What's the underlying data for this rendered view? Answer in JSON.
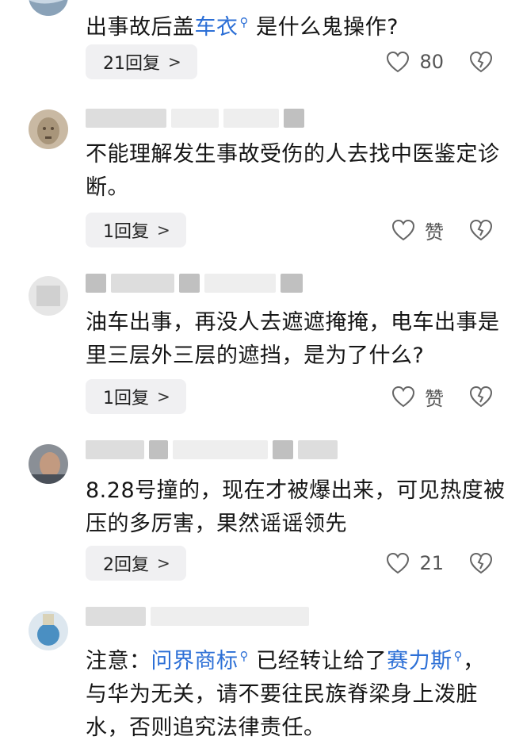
{
  "comments": [
    {
      "text_before": "出事故后盖",
      "link1": "车衣",
      "text_after": "是什么鬼操作?",
      "reply_label": "21回复",
      "like_label": "80"
    },
    {
      "text": "不能理解发生事故受伤的人去找中医鉴定诊断。",
      "reply_label": "1回复",
      "like_label": "赞"
    },
    {
      "text": "油车出事，再没人去遮遮掩掩，电车出事是里三层外三层的遮挡，是为了什么?",
      "reply_label": "1回复",
      "like_label": "赞"
    },
    {
      "text": "8.28号撞的，现在才被爆出来，可见热度被压的多厉害，果然谣谣领先",
      "reply_label": "2回复",
      "like_label": "21"
    },
    {
      "text_before": "注意：",
      "link1": "问界商标",
      "text_mid": "已经转让给了",
      "link2": "赛力斯",
      "text_after": "，与华为无关，请不要往民族脊梁身上泼脏水，否则追究法律责任。"
    }
  ],
  "icons": {
    "chevron": "›",
    "search_mark": "ᵠ"
  },
  "colors": {
    "link": "#2c6fd6",
    "pill_bg": "#f0f0f2"
  }
}
